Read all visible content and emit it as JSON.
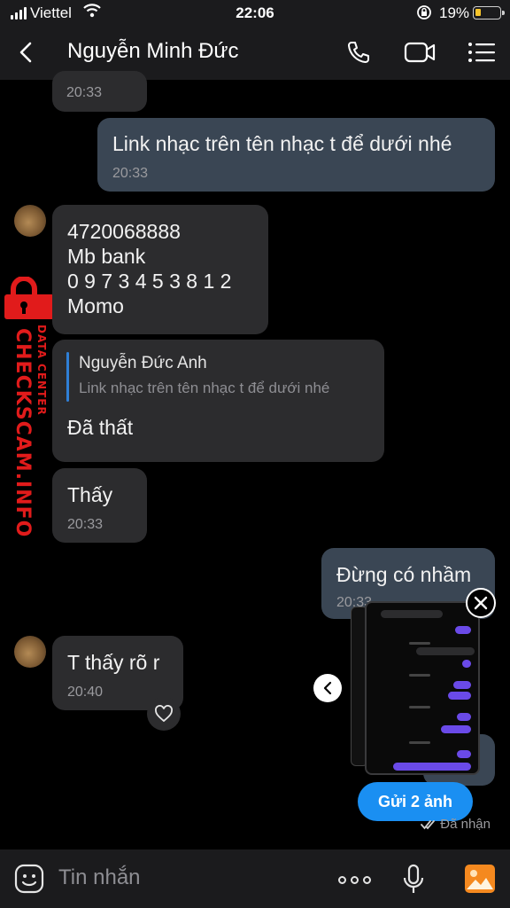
{
  "status_bar": {
    "carrier": "Viettel",
    "time": "22:06",
    "battery": "19%",
    "battery_color": "#f6c42a"
  },
  "header": {
    "contact_name": "Nguyễn Minh Đức"
  },
  "messages": [
    {
      "time": "20:33"
    },
    {
      "text": "Link nhạc trên tên nhạc t để dưới nhé",
      "time": "20:33"
    },
    {
      "lines": [
        "4720068888",
        "Mb bank",
        "0 9 7 3 4 5 3 8 1 2",
        "Momo"
      ]
    },
    {
      "reply_to_name": "Nguyễn Đức Anh",
      "reply_to_text": "Link nhạc trên tên nhạc t để dưới nhé",
      "text": "Đã thất"
    },
    {
      "text": "Thấy",
      "time": "20:33"
    },
    {
      "text": "Đừng có nhầm",
      "time": "20:33"
    },
    {
      "text": "T thấy rõ r",
      "time": "20:40"
    }
  ],
  "photo_preview": {
    "send_label": "Gửi 2 ảnh"
  },
  "receipt": "Đã nhận",
  "input": {
    "placeholder": "Tin nhắn"
  },
  "watermark": {
    "main": "CHECKSCAM.INFO",
    "sub": "DATA CENTER"
  },
  "colors": {
    "accent": "#1a8ff2",
    "link": "#3d8fdd",
    "outgoing_bubble": "#3a4654",
    "incoming_bubble": "#2c2c2e",
    "watermark": "#e11b1b"
  }
}
